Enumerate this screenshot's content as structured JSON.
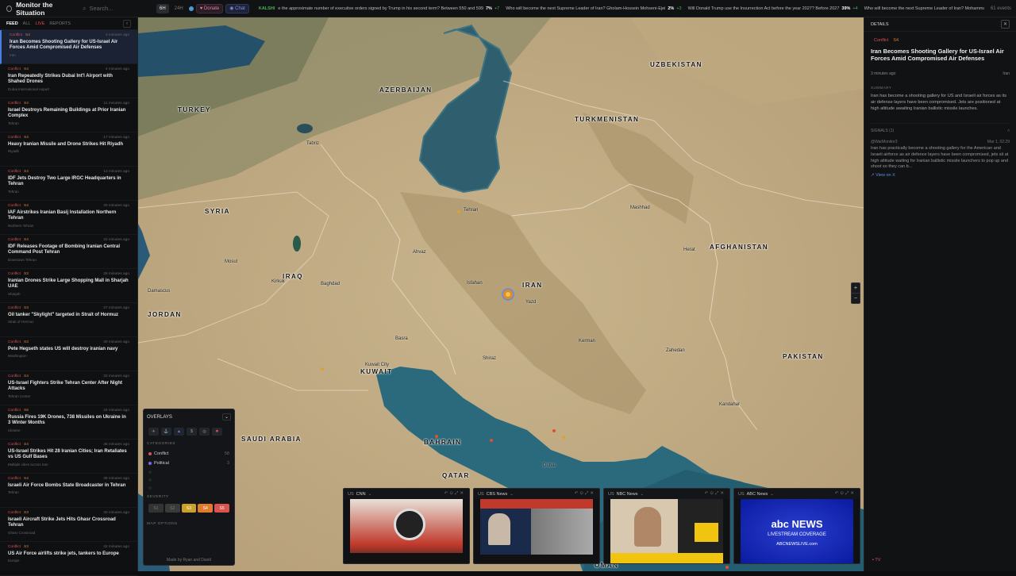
{
  "app": {
    "title": "Monitor the Situation",
    "search_placeholder": "Search...",
    "range_24h": "24H",
    "range_sel": "6H",
    "donate": "♥ Donate",
    "chat": "◉ Chat",
    "events": "61 events"
  },
  "ticker": [
    {
      "k": "KALSHI",
      "t": "e the approximate number of executive orders signed by Trump in his second term? Between 550 and 599",
      "pct": "7%",
      "chg": "+7",
      "chg_color": "#4caf50"
    },
    {
      "t": "Who will become the next Supreme Leader of Iran? Gholam-Hossein Mohseni-Ejei",
      "pct": "2%",
      "chg": "+3",
      "chg_color": "#4caf50"
    },
    {
      "t": "Will Donald Trump use the Insurrection Act before the year 2027? Before 2027",
      "pct": "39%",
      "chg": "+4",
      "chg_color": "#4caf50"
    },
    {
      "t": "Who will become the next Supreme Leader of Iran? Mohammad Mok",
      "pct": "",
      "chg": "",
      "chg_color": "#4caf50"
    }
  ],
  "feed": {
    "tabs": [
      "FEED",
      "ALL",
      "LIVE",
      "REPORTS"
    ],
    "items": [
      {
        "tag": "Conflict",
        "sev": "S4",
        "time": "3 minutes ago",
        "title": "Iran Becomes Shooting Gallery for US-Israel Air Forces Amid Compromised Air Defenses",
        "loc": "Iran"
      },
      {
        "tag": "Conflict",
        "sev": "S4",
        "time": "4 minutes ago",
        "title": "Iran Repeatedly Strikes Dubai Int'l Airport with Shahed Drones",
        "loc": "Dubai International Airport"
      },
      {
        "tag": "Conflict",
        "sev": "S4",
        "time": "11 minutes ago",
        "title": "Israel Destroys Remaining Buildings at Prior Iranian Complex",
        "loc": "Tehran"
      },
      {
        "tag": "Conflict",
        "sev": "S4",
        "time": "17 minutes ago",
        "title": "Heavy Iranian Missile and Drone Strikes Hit Riyadh",
        "loc": "Riyadh"
      },
      {
        "tag": "Conflict",
        "sev": "S4",
        "time": "13 minutes ago",
        "title": "IDF Jets Destroy Two Large IRGC Headquarters in Tehran",
        "loc": "Tehran"
      },
      {
        "tag": "Conflict",
        "sev": "S4",
        "time": "20 minutes ago",
        "title": "IAF Airstrikes Iranian Basij Installation Northern Tehran",
        "loc": "Northern Tehran"
      },
      {
        "tag": "Conflict",
        "sev": "S4",
        "time": "22 minutes ago",
        "title": "IDF Releases Footage of Bombing Iranian Central Command Post Tehran",
        "loc": "Downtown Tehran"
      },
      {
        "tag": "Conflict",
        "sev": "S3",
        "time": "26 minutes ago",
        "title": "Iranian Drones Strike Large Shopping Mall in Sharjah UAE",
        "loc": "Sharjah"
      },
      {
        "tag": "Conflict",
        "sev": "S3",
        "time": "27 minutes ago",
        "title": "Oil tanker \"Skylight\" targeted in Strait of Hormuz",
        "loc": "Strait of Hormuz"
      },
      {
        "tag": "Conflict",
        "sev": "S3",
        "time": "30 minutes ago",
        "title": "Pete Hegseth states US will destroy iranian navy",
        "loc": "Washington"
      },
      {
        "tag": "Conflict",
        "sev": "S4",
        "time": "33 minutes ago",
        "title": "US-Israel Fighters Strike Tehran Center After Night Attacks",
        "loc": "Tehran Center"
      },
      {
        "tag": "Conflict",
        "sev": "S5",
        "time": "34 minutes ago",
        "title": "Russia Fires 19K Drones, 738 Missiles on Ukraine in 3 Winter Months",
        "loc": "Ukraine"
      },
      {
        "tag": "Conflict",
        "sev": "S4",
        "time": "36 minutes ago",
        "title": "US-Israel Strikes Hit 28 Iranian Cities; Iran Retaliates vs US Gulf Bases",
        "loc": "Multiple cities across Iran"
      },
      {
        "tag": "Conflict",
        "sev": "S4",
        "time": "38 minutes ago",
        "title": "Israeli Air Force Bombs State Broadcaster in Tehran",
        "loc": "Tehran"
      },
      {
        "tag": "Conflict",
        "sev": "S3",
        "time": "40 minutes ago",
        "title": "Israeli Aircraft Strike Jets Hits Ghasr Crossroad Tehran",
        "loc": "Ghasr Crossroad"
      },
      {
        "tag": "Conflict",
        "sev": "S3",
        "time": "42 minutes ago",
        "title": "US Air Force airlifts strike jets, tankers to Europe",
        "loc": "Europe"
      }
    ]
  },
  "map": {
    "countries": [
      {
        "n": "TURKEY"
      },
      {
        "n": "SYRIA"
      },
      {
        "n": "IRAQ"
      },
      {
        "n": "JORDAN"
      },
      {
        "n": "KUWAIT"
      },
      {
        "n": "SAUDI ARABIA"
      },
      {
        "n": "IRAN"
      },
      {
        "n": "TURKMENISTAN"
      },
      {
        "n": "UZBEKISTAN"
      },
      {
        "n": "AFGHANISTAN"
      },
      {
        "n": "PAKISTAN"
      },
      {
        "n": "AZERBAIJAN"
      },
      {
        "n": "BAHRAIN"
      },
      {
        "n": "QATAR"
      },
      {
        "n": "OMAN"
      }
    ],
    "cities": [
      "Tehran",
      "Isfahan",
      "Mashhad",
      "Shiraz",
      "Baghdad",
      "Kirkuk",
      "Mosul",
      "Basra",
      "Kuwait City",
      "Dubai",
      "Ahvaz",
      "Kerman",
      "Zahedan",
      "Herat",
      "Kandahar",
      "Tabriz",
      "Damascus",
      "Yazd"
    ],
    "zoom_in": "+",
    "zoom_out": "−"
  },
  "overlays": {
    "title": "OVERLAYS",
    "categories_label": "CATEGORIES",
    "categories": [
      {
        "name": "Conflict",
        "count": "58",
        "color": "#d9534f"
      },
      {
        "name": "Political",
        "count": "3",
        "color": "#7b68ee"
      }
    ],
    "severity_label": "SEVERITY",
    "severity": [
      {
        "l": "S1",
        "c": "#333"
      },
      {
        "l": "S2",
        "c": "#3a3a3a"
      },
      {
        "l": "S3",
        "c": "#c9a227"
      },
      {
        "l": "S4",
        "c": "#e07b2e"
      },
      {
        "l": "S5",
        "c": "#d9534f"
      }
    ],
    "map_options": "MAP OPTIONS",
    "made_by": "Made by Ryan and David"
  },
  "tv": [
    {
      "name": "CNN",
      "cc": "US"
    },
    {
      "name": "CBS News",
      "cc": "US"
    },
    {
      "name": "NBC News",
      "cc": "US"
    },
    {
      "name": "ABC News",
      "cc": "US"
    }
  ],
  "details": {
    "header": "DETAILS",
    "tag": "Conflict",
    "sev": "S4",
    "title": "Iran Becomes Shooting Gallery for US-Israel Air Forces Amid Compromised Air Defenses",
    "time": "3 minutes ago",
    "loc": "Iran",
    "summary_label": "SUMMARY",
    "summary": "Iran has become a shooting gallery for US and Israeli air forces as its air defense layers have been compromised. Jets are positioned at high altitude awaiting Iranian ballistic missile launches.",
    "signals_label": "SIGNALS (1)",
    "signal_user": "@WarMonitor3",
    "signal_time": "Mar 1, 02:29",
    "signal_text": "Iran has practically become a shooting gallery for the American and Israeli airforce as air defence layers have been compromised, jets sit at high altitude waiting for Iranian ballistic missile launchers to pop up and shoot so they can b...",
    "view": "↗ View on X",
    "tv_label": "▪ TV"
  },
  "colors": {
    "accent": "#4a7ee0",
    "conflict": "#d9534f",
    "bg": "#0f1012"
  }
}
